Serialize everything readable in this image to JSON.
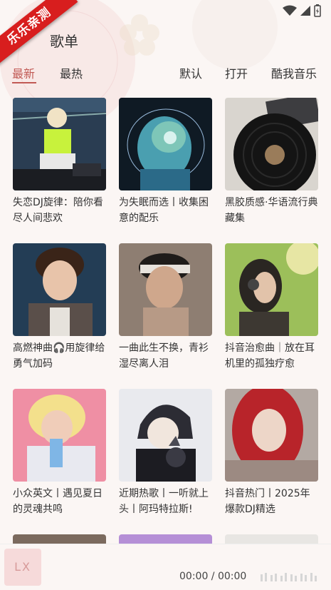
{
  "corner_badge": "乐乐亲测",
  "header": {
    "title": "歌单"
  },
  "sort_tabs": [
    {
      "label": "最新",
      "active": true
    },
    {
      "label": "最热",
      "active": false
    }
  ],
  "actions": [
    {
      "label": "默认"
    },
    {
      "label": "打开"
    },
    {
      "label": "酷我音乐"
    }
  ],
  "playlists": [
    {
      "title": "失恋DJ旋律：陪你看尽人间悲欢",
      "cover": "dj-girl"
    },
    {
      "title": "为失眠而选丨收集困意的配乐",
      "cover": "night-art"
    },
    {
      "title": "黑胶质感·华语流行典藏集",
      "cover": "vinyl"
    },
    {
      "title": "高燃神曲🎧用旋律给勇气加码",
      "cover": "singer-boy"
    },
    {
      "title": "一曲此生不换，青衫湿尽离人泪",
      "cover": "headband-man"
    },
    {
      "title": "抖音治愈曲｜放在耳机里的孤独疗愈",
      "cover": "headphone-girl"
    },
    {
      "title": "小众英文丨遇见夏日的灵魂共鸣",
      "cover": "drink-girl"
    },
    {
      "title": "近期热歌丨一听就上头丨阿玛特拉斯!",
      "cover": "anime-cat"
    },
    {
      "title": "抖音热门丨2025年爆款DJ精选",
      "cover": "red-hair-girl"
    }
  ],
  "player": {
    "cover_text": "LX",
    "time": "00:00 / 00:00"
  },
  "colors": {
    "accent": "#c15a55",
    "badge": "#d81e1e"
  }
}
